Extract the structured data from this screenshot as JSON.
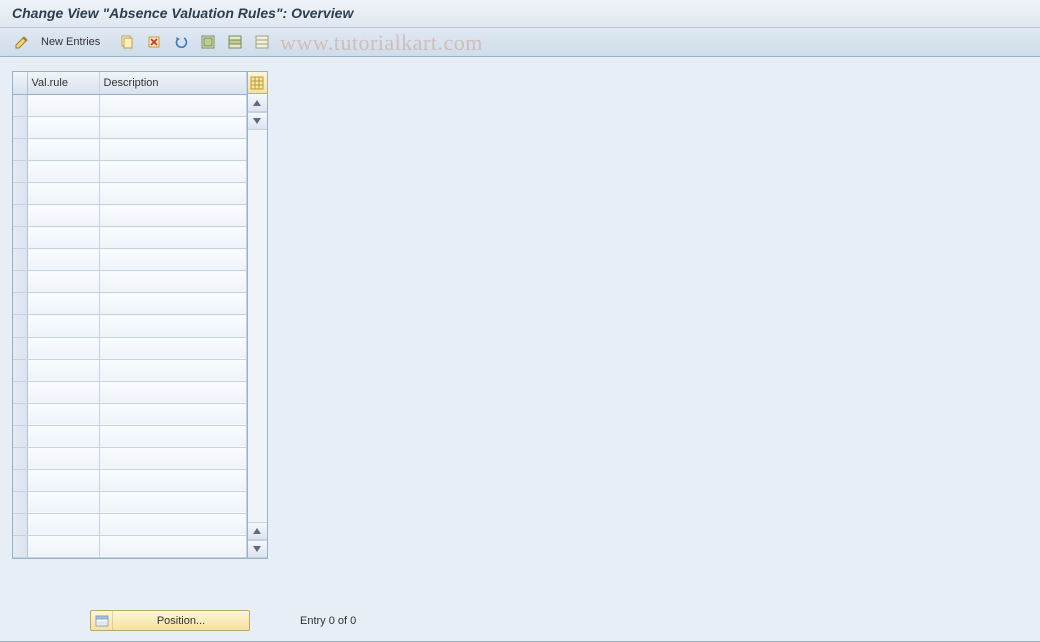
{
  "header": {
    "title": "Change View \"Absence Valuation Rules\": Overview"
  },
  "toolbar": {
    "new_entries_label": "New Entries"
  },
  "watermark": "www.tutorialkart.com",
  "table": {
    "columns": {
      "val_rule": "Val.rule",
      "description": "Description"
    },
    "row_count": 21
  },
  "footer": {
    "position_label": "Position...",
    "entry_text": "Entry 0 of 0"
  },
  "icons": {
    "edit": "edit-icon",
    "copy": "copy-icon",
    "delete": "delete-icon",
    "undo": "undo-icon",
    "select_all": "select-all-icon",
    "select_block": "select-block-icon",
    "deselect_all": "deselect-all-icon",
    "config": "config-icon",
    "scroll_up": "scroll-up-icon",
    "scroll_down": "scroll-down-icon"
  }
}
